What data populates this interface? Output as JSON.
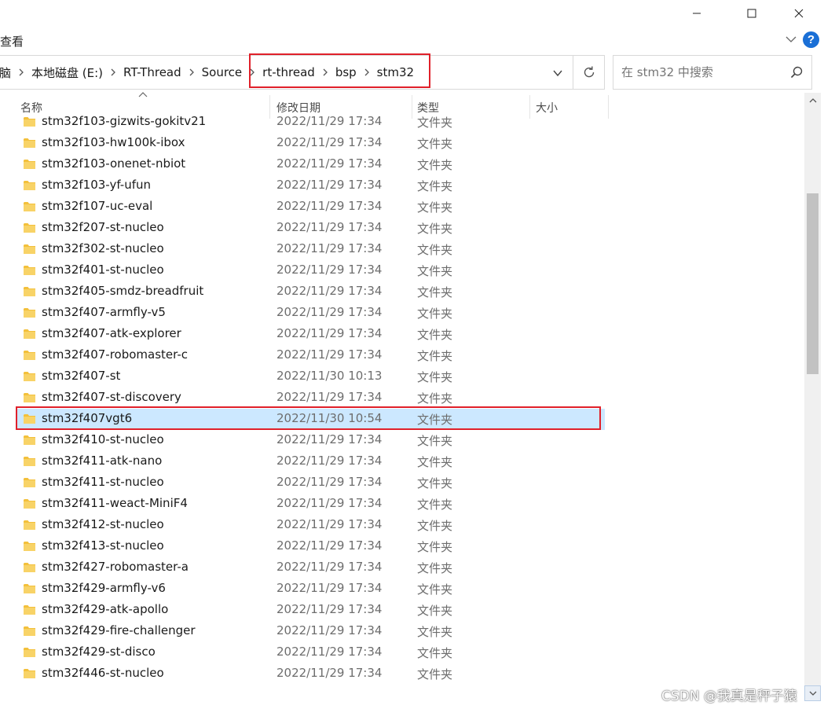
{
  "window": {
    "controls": {
      "minimize": "minimize",
      "maximize": "maximize",
      "close": "close"
    }
  },
  "ribbon": {
    "view_tab": "查看"
  },
  "address": {
    "crumbs": [
      "脑",
      "本地磁盘 (E:)",
      "RT-Thread",
      "Source",
      "rt-thread",
      "bsp",
      "stm32"
    ]
  },
  "search": {
    "placeholder": "在 stm32 中搜索"
  },
  "columns": {
    "name": "名称",
    "modified": "修改日期",
    "type": "类型",
    "size": "大小"
  },
  "files": [
    {
      "name": "stm32f103-gizwits-gokitv21",
      "modified": "2022/11/29 17:34",
      "type": "文件夹"
    },
    {
      "name": "stm32f103-hw100k-ibox",
      "modified": "2022/11/29 17:34",
      "type": "文件夹"
    },
    {
      "name": "stm32f103-onenet-nbiot",
      "modified": "2022/11/29 17:34",
      "type": "文件夹"
    },
    {
      "name": "stm32f103-yf-ufun",
      "modified": "2022/11/29 17:34",
      "type": "文件夹"
    },
    {
      "name": "stm32f107-uc-eval",
      "modified": "2022/11/29 17:34",
      "type": "文件夹"
    },
    {
      "name": "stm32f207-st-nucleo",
      "modified": "2022/11/29 17:34",
      "type": "文件夹"
    },
    {
      "name": "stm32f302-st-nucleo",
      "modified": "2022/11/29 17:34",
      "type": "文件夹"
    },
    {
      "name": "stm32f401-st-nucleo",
      "modified": "2022/11/29 17:34",
      "type": "文件夹"
    },
    {
      "name": "stm32f405-smdz-breadfruit",
      "modified": "2022/11/29 17:34",
      "type": "文件夹"
    },
    {
      "name": "stm32f407-armfly-v5",
      "modified": "2022/11/29 17:34",
      "type": "文件夹"
    },
    {
      "name": "stm32f407-atk-explorer",
      "modified": "2022/11/29 17:34",
      "type": "文件夹"
    },
    {
      "name": "stm32f407-robomaster-c",
      "modified": "2022/11/29 17:34",
      "type": "文件夹"
    },
    {
      "name": "stm32f407-st",
      "modified": "2022/11/30 10:13",
      "type": "文件夹"
    },
    {
      "name": "stm32f407-st-discovery",
      "modified": "2022/11/29 17:34",
      "type": "文件夹"
    },
    {
      "name": "stm32f407vgt6",
      "modified": "2022/11/30 10:54",
      "type": "文件夹",
      "selected": true
    },
    {
      "name": "stm32f410-st-nucleo",
      "modified": "2022/11/29 17:34",
      "type": "文件夹"
    },
    {
      "name": "stm32f411-atk-nano",
      "modified": "2022/11/29 17:34",
      "type": "文件夹"
    },
    {
      "name": "stm32f411-st-nucleo",
      "modified": "2022/11/29 17:34",
      "type": "文件夹"
    },
    {
      "name": "stm32f411-weact-MiniF4",
      "modified": "2022/11/29 17:34",
      "type": "文件夹"
    },
    {
      "name": "stm32f412-st-nucleo",
      "modified": "2022/11/29 17:34",
      "type": "文件夹"
    },
    {
      "name": "stm32f413-st-nucleo",
      "modified": "2022/11/29 17:34",
      "type": "文件夹"
    },
    {
      "name": "stm32f427-robomaster-a",
      "modified": "2022/11/29 17:34",
      "type": "文件夹"
    },
    {
      "name": "stm32f429-armfly-v6",
      "modified": "2022/11/29 17:34",
      "type": "文件夹"
    },
    {
      "name": "stm32f429-atk-apollo",
      "modified": "2022/11/29 17:34",
      "type": "文件夹"
    },
    {
      "name": "stm32f429-fire-challenger",
      "modified": "2022/11/29 17:34",
      "type": "文件夹"
    },
    {
      "name": "stm32f429-st-disco",
      "modified": "2022/11/29 17:34",
      "type": "文件夹"
    },
    {
      "name": "stm32f446-st-nucleo",
      "modified": "2022/11/29 17:34",
      "type": "文件夹"
    }
  ],
  "watermark": "CSDN @我真是秤子猿",
  "colors": {
    "accent": "#1a6fd6",
    "selection": "#cce8ff",
    "highlight": "#e0202a",
    "folder": "#f3c03b"
  }
}
